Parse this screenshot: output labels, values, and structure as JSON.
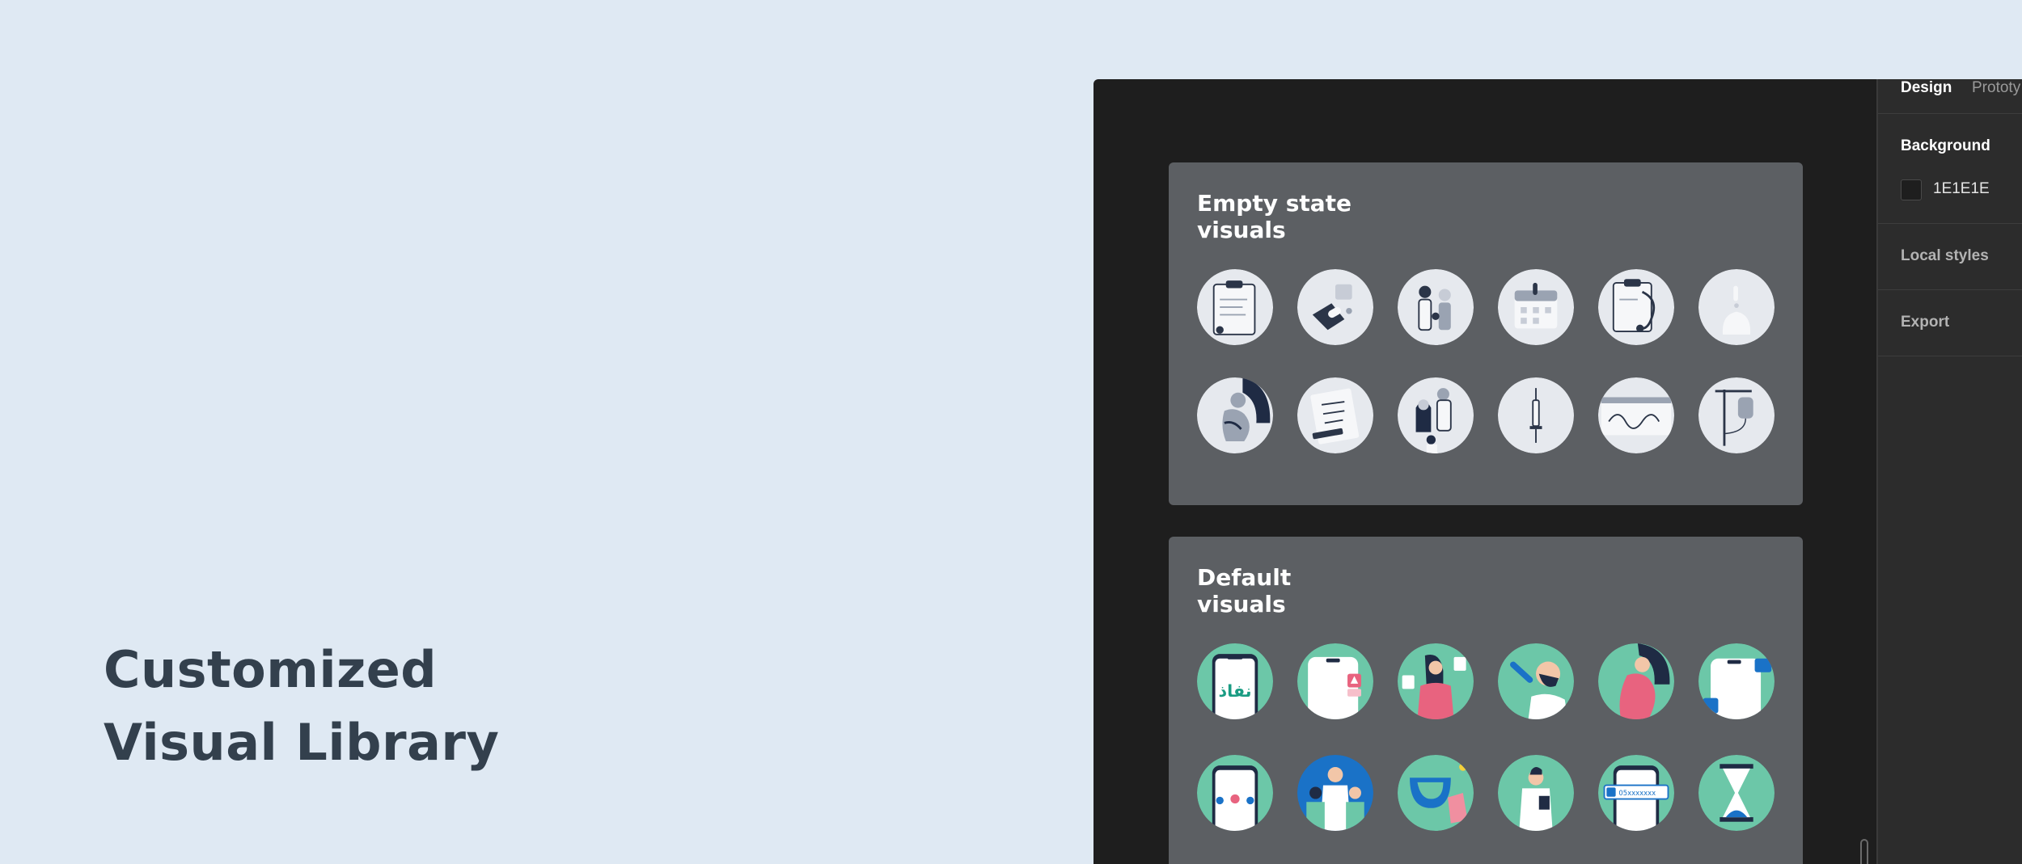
{
  "headline": {
    "line1": "Customized",
    "line2": "Visual Library"
  },
  "canvas": {
    "empty_section": {
      "title": "Empty state\nvisuals",
      "items": [
        "clipboard-document-icon",
        "hand-pill-icon",
        "family-group-icon",
        "calendar-icon",
        "clipboard-stethoscope-icon",
        "water-drop-icon",
        "pregnant-woman-icon",
        "prescription-paper-icon",
        "family-doctor-icon",
        "syringe-icon",
        "heart-monitor-icon",
        "iv-drip-icon"
      ]
    },
    "default_section": {
      "title": "Default\nvisuals",
      "brand_text": "نفاذ",
      "phone_number": "05xxxxxxx",
      "items": [
        "phone-nafath-icon",
        "phone-alert-icon",
        "mother-baby-icon",
        "doctor-swab-icon",
        "pregnant-woman-icon",
        "phone-video-call-icon",
        "phone-connect-icon",
        "doctors-team-icon",
        "dental-cleaning-icon",
        "doctor-clipboard-icon",
        "phone-call-icon",
        "hourglass-icon"
      ]
    }
  },
  "panel": {
    "tabs": {
      "design": "Design",
      "prototype": "Prototy"
    },
    "background_label": "Background",
    "background_value": "1E1E1E",
    "local_styles_label": "Local styles",
    "export_label": "Export"
  },
  "colors": {
    "page_bg": "#dfe9f3",
    "app_bg": "#1e1e1e",
    "section_bg": "#5c5f63",
    "teal": "#6cc7a8",
    "navy": "#1f2b44",
    "pink": "#e8637f",
    "blue": "#1a72c7"
  }
}
